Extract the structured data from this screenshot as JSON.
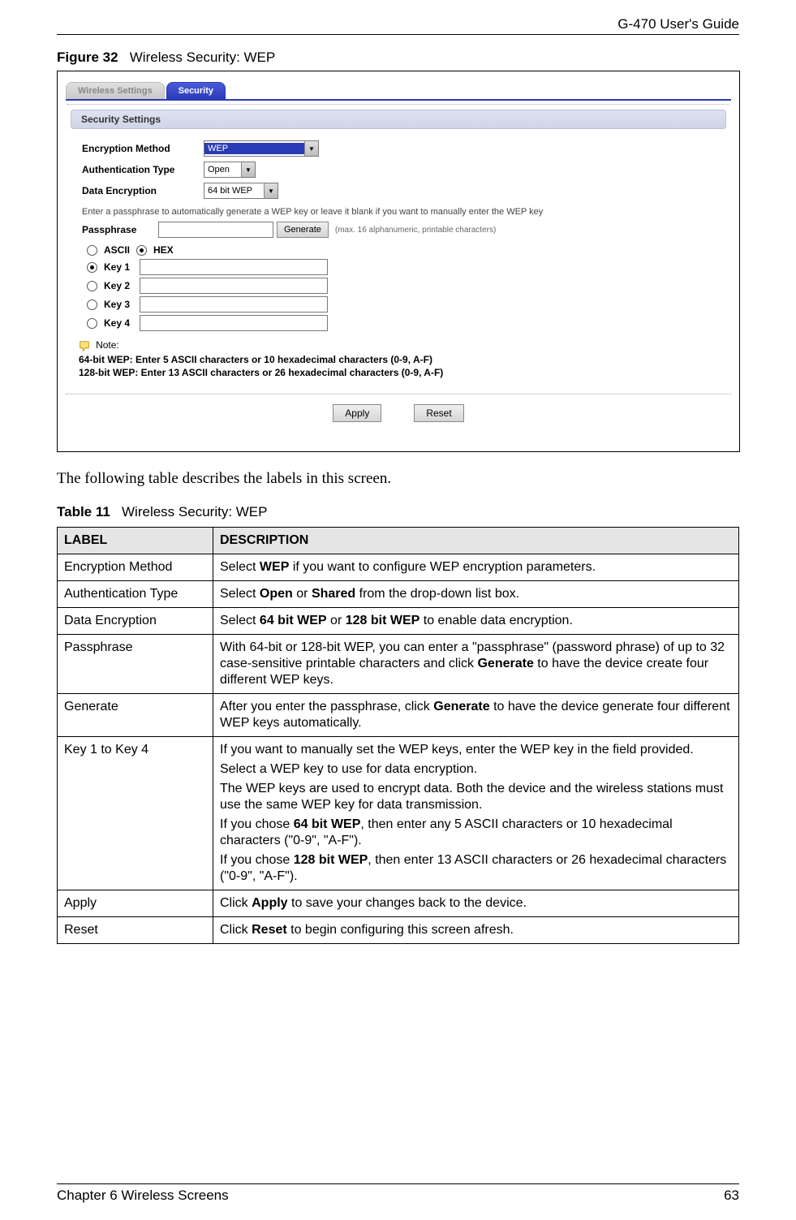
{
  "header": {
    "guide_title": "G-470 User's Guide"
  },
  "figure": {
    "label": "Figure 32",
    "title": "Wireless Security: WEP"
  },
  "tabs": {
    "wireless_settings": "Wireless Settings",
    "security": "Security"
  },
  "section_title": "Security Settings",
  "form": {
    "encryption_method": {
      "label": "Encryption Method",
      "value": "WEP"
    },
    "auth_type": {
      "label": "Authentication Type",
      "value": "Open"
    },
    "data_encryption": {
      "label": "Data Encryption",
      "value": "64 bit WEP"
    },
    "hint": "Enter a passphrase to automatically generate a WEP key or leave it blank if you want to manually enter the WEP key",
    "passphrase": {
      "label": "Passphrase",
      "generate": "Generate",
      "maxchars": "(max. 16 alphanumeric, printable characters)"
    },
    "radio": {
      "ascii": "ASCII",
      "hex": "HEX"
    },
    "keys": {
      "k1": "Key 1",
      "k2": "Key 2",
      "k3": "Key 3",
      "k4": "Key 4"
    },
    "note_title": "Note:",
    "note_line1": "64-bit WEP: Enter 5 ASCII characters or 10 hexadecimal characters (0-9, A-F)",
    "note_line2": "128-bit WEP: Enter 13 ASCII characters or 26 hexadecimal characters (0-9, A-F)",
    "apply": "Apply",
    "reset": "Reset"
  },
  "body_para": "The following table describes the labels in this screen.",
  "table": {
    "label": "Table 11",
    "title": "Wireless Security: WEP",
    "head_label": "LABEL",
    "head_desc": "DESCRIPTION",
    "rows": {
      "r1": {
        "label": "Encryption Method",
        "p1a": "Select ",
        "p1b": "WEP",
        "p1c": " if you want to configure WEP encryption parameters."
      },
      "r2": {
        "label": "Authentication Type",
        "p1a": "Select ",
        "p1b": "Open",
        "p1c": " or ",
        "p1d": "Shared",
        "p1e": " from the drop-down list box."
      },
      "r3": {
        "label": "Data Encryption",
        "p1a": "Select ",
        "p1b": "64 bit WEP",
        "p1c": " or ",
        "p1d": "128 bit WEP",
        "p1e": " to enable data encryption."
      },
      "r4": {
        "label": "Passphrase",
        "p1a": "With 64-bit or 128-bit WEP, you can enter a \"passphrase\" (password phrase) of up to 32 case-sensitive printable characters and click ",
        "p1b": "Generate",
        "p1c": " to have the device create four different WEP keys."
      },
      "r5": {
        "label": "Generate",
        "p1a": "After you enter the passphrase, click ",
        "p1b": "Generate",
        "p1c": " to have the device generate four different WEP keys automatically."
      },
      "r6": {
        "label": "Key 1 to Key 4",
        "p1": "If you want to manually set the WEP keys, enter the WEP key in the field provided.",
        "p2": "Select a WEP key to use for data encryption.",
        "p3": "The WEP keys are used to encrypt data. Both the device and the wireless stations must use the same WEP key for data transmission.",
        "p4a": "If you chose ",
        "p4b": "64 bit WEP",
        "p4c": ", then enter any 5 ASCII characters or 10 hexadecimal characters (\"0-9\", \"A-F\").",
        "p5a": "If you chose ",
        "p5b": "128 bit WEP",
        "p5c": ", then enter 13 ASCII characters or 26 hexadecimal characters (\"0-9\", \"A-F\")."
      },
      "r7": {
        "label": "Apply",
        "p1a": "Click ",
        "p1b": "Apply",
        "p1c": " to save your changes back to the device."
      },
      "r8": {
        "label": "Reset",
        "p1a": "Click ",
        "p1b": "Reset",
        "p1c": " to begin configuring this screen afresh."
      }
    }
  },
  "footer": {
    "chapter": "Chapter 6 Wireless Screens",
    "page": "63"
  }
}
